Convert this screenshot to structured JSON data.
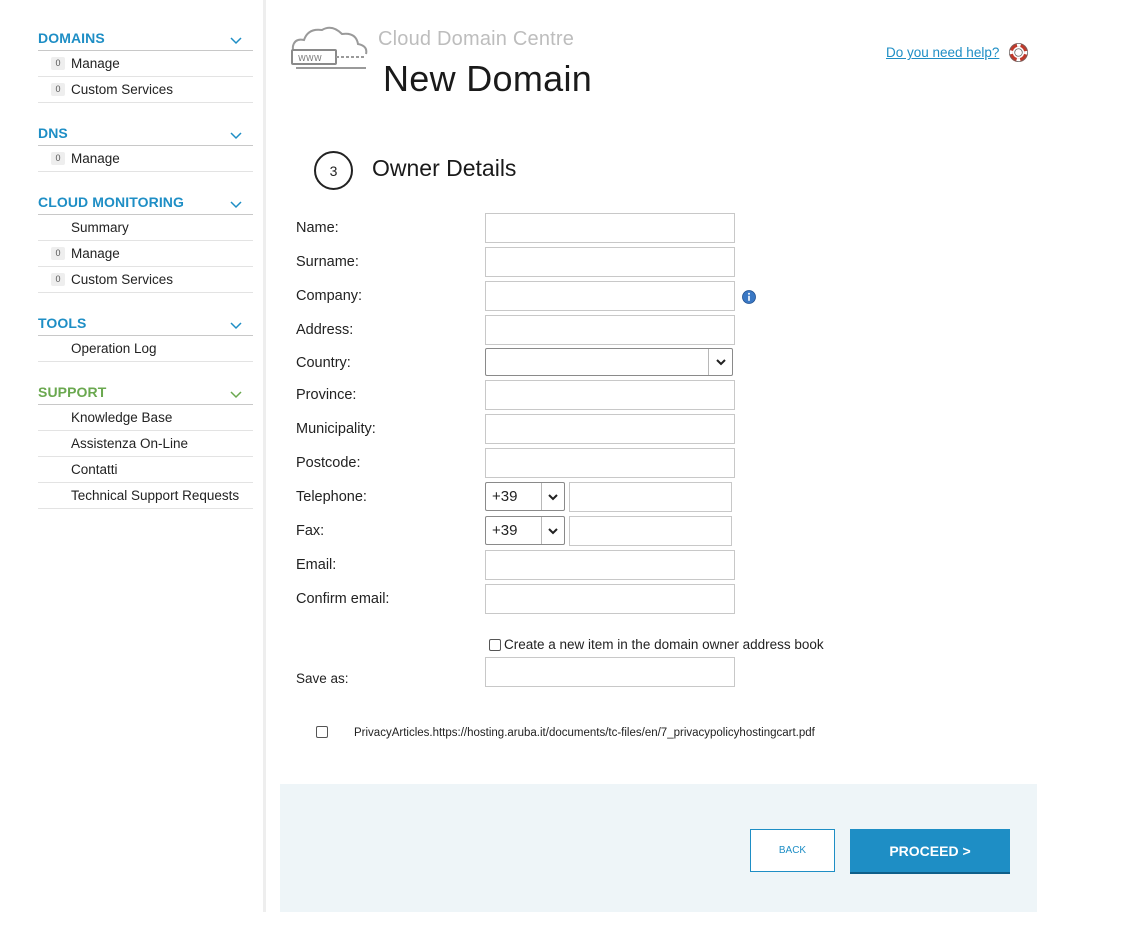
{
  "sidebar": {
    "domains": {
      "title": "DOMAINS",
      "items": [
        {
          "count": "0",
          "label": "Manage"
        },
        {
          "count": "0",
          "label": "Custom Services"
        }
      ]
    },
    "dns": {
      "title": "DNS",
      "items": [
        {
          "count": "0",
          "label": "Manage"
        }
      ]
    },
    "cloud_monitoring": {
      "title": "CLOUD MONITORING",
      "items": [
        {
          "count": "",
          "label": "Summary"
        },
        {
          "count": "0",
          "label": "Manage"
        },
        {
          "count": "0",
          "label": "Custom Services"
        }
      ]
    },
    "tools": {
      "title": "TOOLS",
      "items": [
        {
          "count": "",
          "label": "Operation Log"
        }
      ]
    },
    "support": {
      "title": "SUPPORT",
      "items": [
        {
          "count": "",
          "label": "Knowledge Base"
        },
        {
          "count": "",
          "label": "Assistenza On-Line"
        },
        {
          "count": "",
          "label": "Contatti"
        },
        {
          "count": "",
          "label": "Technical Support Requests"
        }
      ]
    }
  },
  "header": {
    "brand": "Cloud Domain Centre",
    "logo_text": "WWW",
    "title": "New Domain",
    "help_link": "Do you need help?"
  },
  "step": {
    "number": "3",
    "title": "Owner Details"
  },
  "form": {
    "name_label": "Name:",
    "name_value": "",
    "surname_label": "Surname:",
    "surname_value": "",
    "company_label": "Company:",
    "company_value": "",
    "address_label": "Address:",
    "address_value": "",
    "country_label": "Country:",
    "country_value": "",
    "province_label": "Province:",
    "province_value": "",
    "municipality_label": "Municipality:",
    "municipality_value": "",
    "postcode_label": "Postcode:",
    "postcode_value": "",
    "telephone_label": "Telephone:",
    "telephone_prefix": "+39",
    "telephone_value": "",
    "fax_label": "Fax:",
    "fax_prefix": "+39",
    "fax_value": "",
    "email_label": "Email:",
    "email_value": "",
    "confirm_email_label": "Confirm email:",
    "confirm_email_value": "",
    "address_book_checkbox_label": "Create a new item in the domain owner address book",
    "save_as_label": "Save as:",
    "save_as_value": "",
    "privacy_label": "PrivacyArticles.https://hosting.aruba.it/documents/tc-files/en/7_privacypolicyhostingcart.pdf"
  },
  "actions": {
    "back_label": "BACK",
    "proceed_label": "PROCEED >"
  },
  "colors": {
    "accent": "#1e8ec5",
    "support_green": "#6aa84f",
    "footer_bg": "#eef5f8"
  },
  "icons": {
    "section_toggle": "chevron-down-icon",
    "help": "lifebuoy-icon",
    "info": "info-icon",
    "logo": "cloud-www-icon",
    "select_arrow": "chevron-down-icon"
  }
}
